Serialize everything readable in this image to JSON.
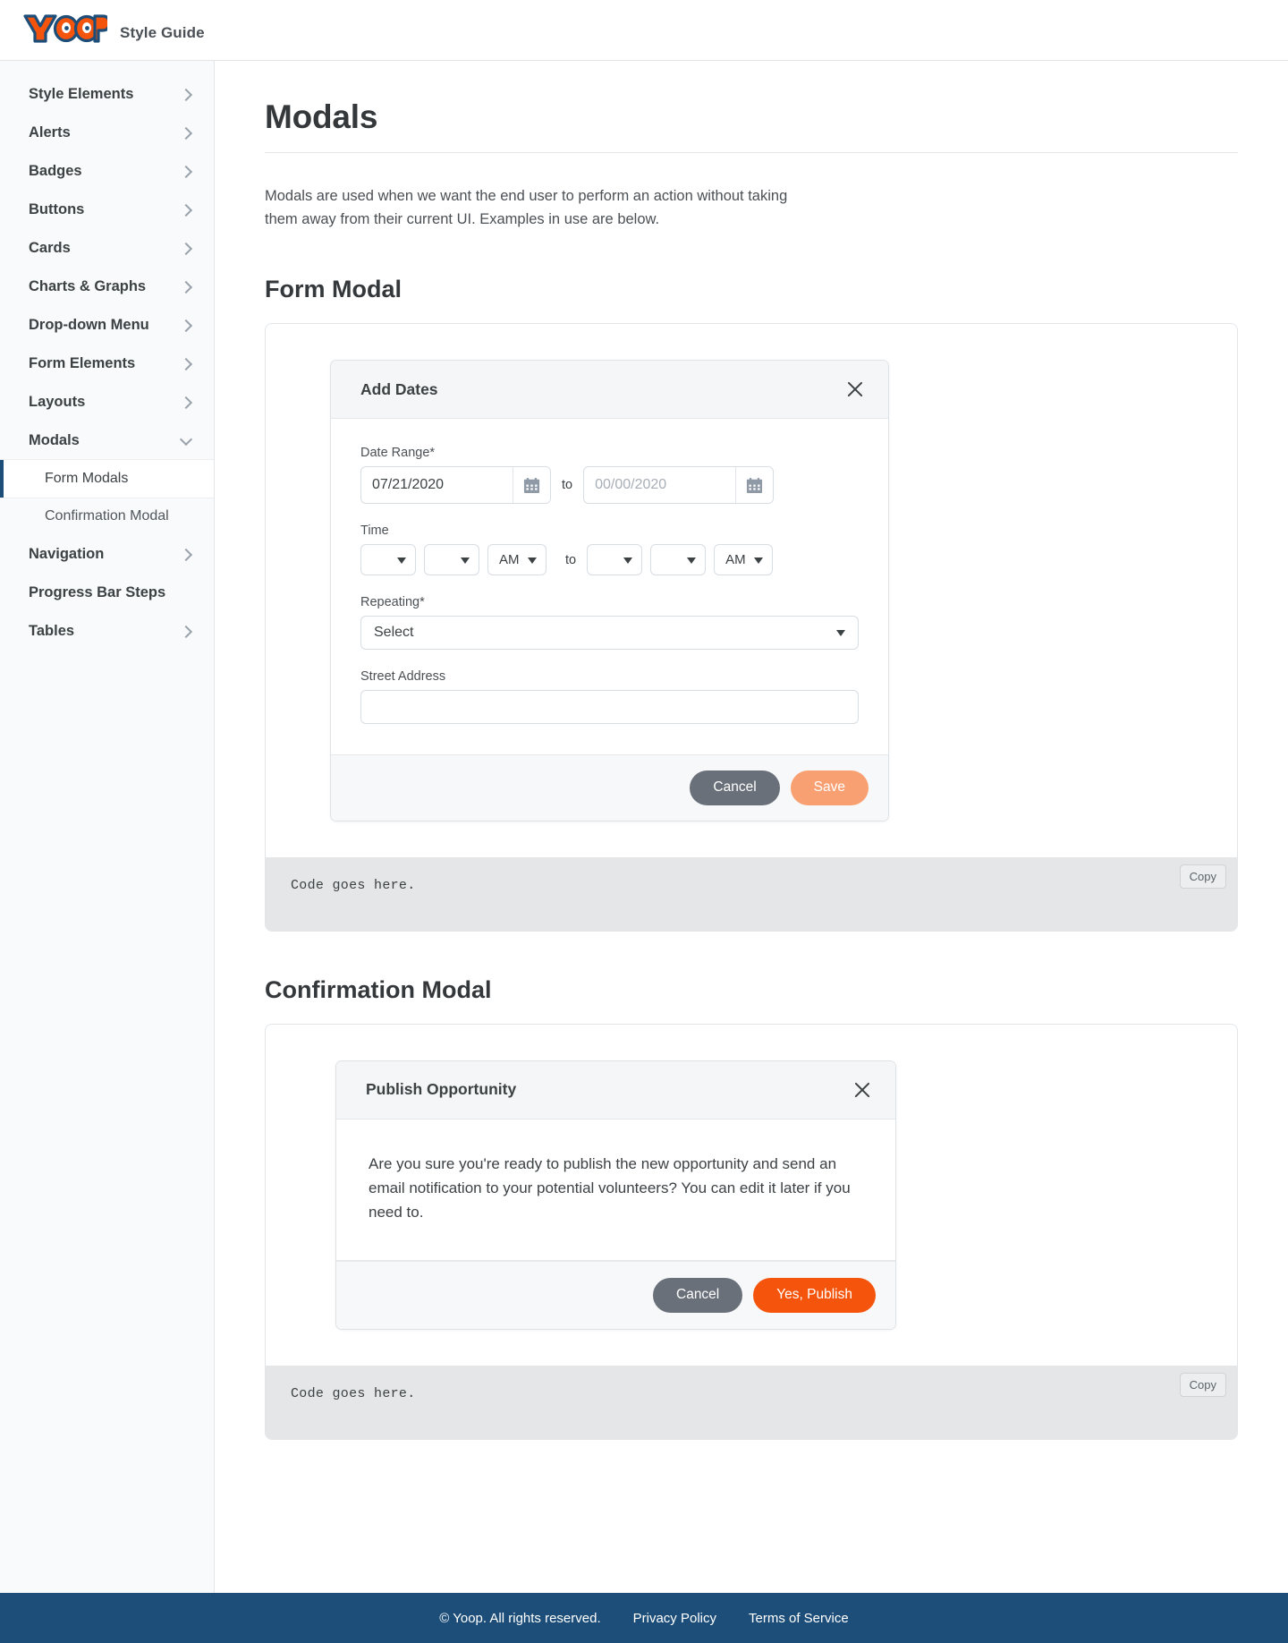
{
  "header": {
    "logo_text": "YOOP",
    "subtitle": "Style Guide"
  },
  "sidebar": {
    "items": [
      {
        "label": "Style Elements",
        "icon": "chevron-right-icon",
        "expanded": false
      },
      {
        "label": "Alerts",
        "icon": "chevron-right-icon",
        "expanded": false
      },
      {
        "label": "Badges",
        "icon": "chevron-right-icon",
        "expanded": false
      },
      {
        "label": "Buttons",
        "icon": "chevron-right-icon",
        "expanded": false
      },
      {
        "label": "Cards",
        "icon": "chevron-right-icon",
        "expanded": false
      },
      {
        "label": "Charts & Graphs",
        "icon": "chevron-right-icon",
        "expanded": false
      },
      {
        "label": "Drop-down Menu",
        "icon": "chevron-right-icon",
        "expanded": false
      },
      {
        "label": "Form Elements",
        "icon": "chevron-right-icon",
        "expanded": false
      },
      {
        "label": "Layouts",
        "icon": "chevron-right-icon",
        "expanded": false
      },
      {
        "label": "Modals",
        "icon": "chevron-down-icon",
        "expanded": true
      },
      {
        "label": "Navigation",
        "icon": "chevron-right-icon",
        "expanded": false
      },
      {
        "label": "Progress Bar Steps",
        "icon": "none",
        "expanded": false
      },
      {
        "label": "Tables",
        "icon": "chevron-right-icon",
        "expanded": false
      }
    ],
    "sub_items": [
      {
        "label": "Form Modals",
        "active": true
      },
      {
        "label": "Confirmation Modal",
        "active": false
      }
    ],
    "active_accent": "#1d4e79"
  },
  "main": {
    "page_title": "Modals",
    "intro": "Modals are used when we want the end user to perform an action without taking them away from their current UI. Examples in use are below.",
    "section_form": "Form Modal",
    "section_confirm": "Confirmation Modal",
    "code_text": "Code goes here.",
    "copy_label": "Copy"
  },
  "form_modal": {
    "title": "Add Dates",
    "close_icon": "close-icon",
    "date_range": {
      "label": "Date Range*",
      "start_value": "07/21/2020",
      "start_placeholder": "00/00/2020",
      "end_value": "",
      "end_placeholder": "00/00/2020",
      "separator": "to",
      "calendar_icon": "calendar-icon"
    },
    "time": {
      "label": "Time",
      "start_hour": "",
      "start_minute": "",
      "start_meridiem": "AM",
      "separator": "to",
      "end_hour": "",
      "end_minute": "",
      "end_meridiem": "AM"
    },
    "repeating": {
      "label": "Repeating*",
      "value": "Select"
    },
    "street_address": {
      "label": "Street Address",
      "value": "",
      "placeholder": ""
    },
    "cancel_label": "Cancel",
    "save_label": "Save",
    "cancel_color": "#6a707a",
    "save_color": "#f9a072"
  },
  "confirm_modal": {
    "title": "Publish Opportunity",
    "close_icon": "close-icon",
    "body": "Are you sure you're ready to publish the new opportunity and send an email notification to your potential volunteers? You can edit it later if you need to.",
    "cancel_label": "Cancel",
    "publish_label": "Yes, Publish",
    "cancel_color": "#6a707a",
    "publish_color": "#f4540c"
  },
  "footer": {
    "copyright": "© Yoop. All rights reserved.",
    "privacy": "Privacy Policy",
    "terms": "Terms of Service",
    "background": "#1d4e79"
  }
}
